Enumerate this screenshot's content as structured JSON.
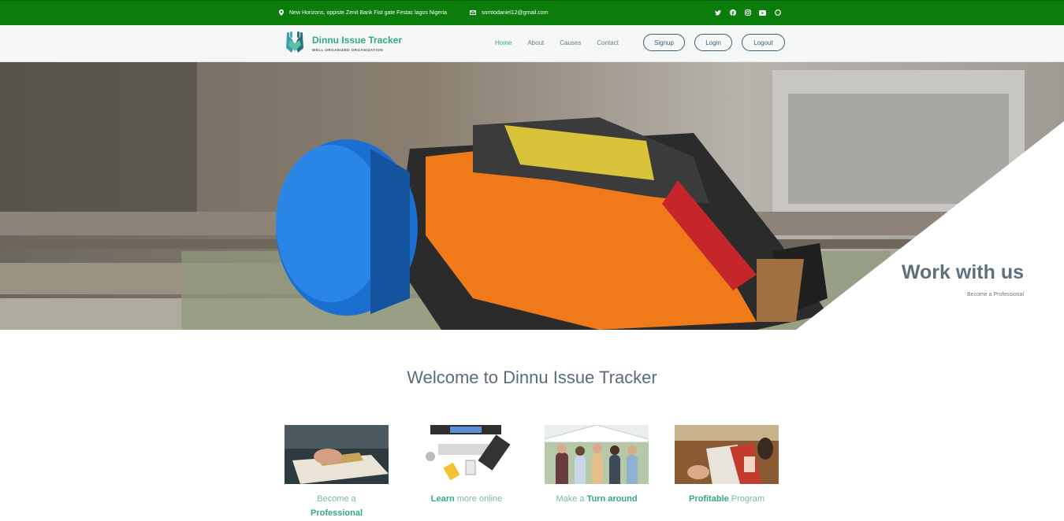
{
  "topbar": {
    "address": "New Horizons, oppiste Zenit Bank Fist gate Festac lagos Nigeria",
    "email": "somtodaniel12@gmail.com",
    "social_icons": [
      "twitter-icon",
      "facebook-icon",
      "instagram-icon",
      "youtube-icon",
      "whatsapp-icon"
    ]
  },
  "brand": {
    "name": "Dinnu Issue Tracker",
    "tagline": "WELL ORGANIZED ORGANIZATION"
  },
  "nav": {
    "links": [
      "Home",
      "About",
      "Causes",
      "Contact"
    ],
    "buttons": [
      "Signup",
      "Login",
      "Logout"
    ]
  },
  "hero": {
    "title": "Work with us",
    "subtitle": "Become a Professional"
  },
  "welcome": "Welcome to Dinnu Issue Tracker",
  "cards": [
    {
      "pre": "Become a",
      "strong": "Professional",
      "post": ""
    },
    {
      "pre": "",
      "strong": "Learn",
      "post": "more online"
    },
    {
      "pre": "Make a",
      "strong": "Turn around",
      "post": ""
    },
    {
      "pre": "",
      "strong": "Profitable",
      "post": "Program"
    }
  ],
  "colors": {
    "topbar": "#0a7d0a",
    "accent": "#2fa889",
    "nav_text": "#3d5f77"
  }
}
